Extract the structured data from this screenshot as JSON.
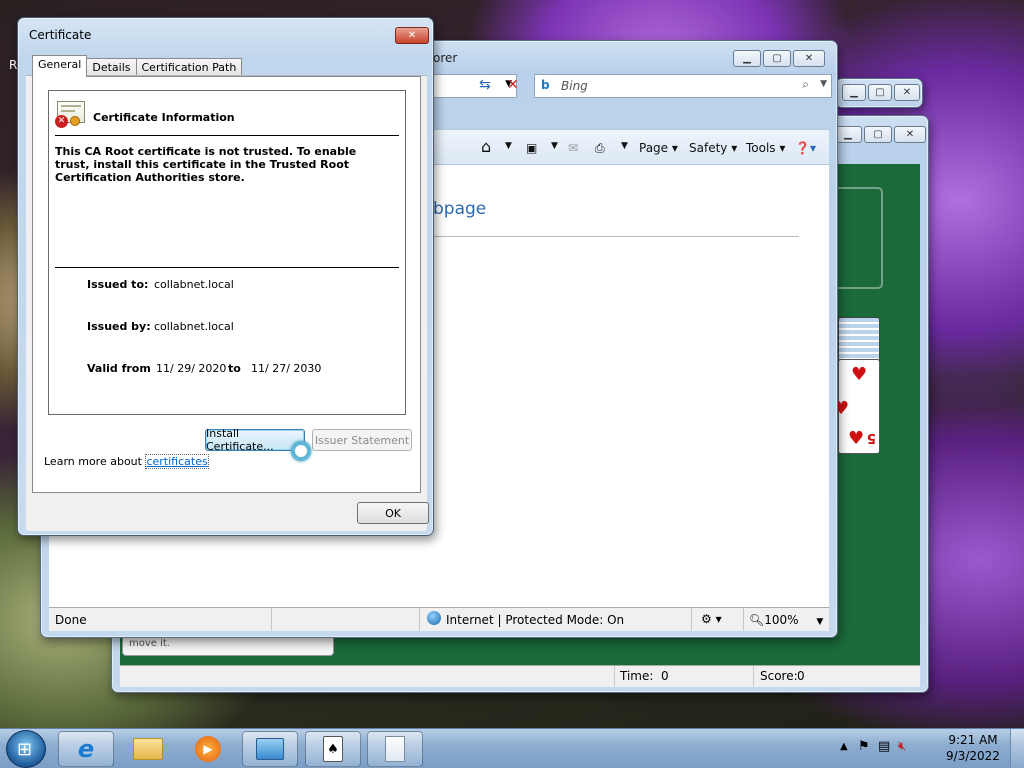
{
  "desktop": {
    "partial_text": "R"
  },
  "solitaire": {
    "time_label": "Time:",
    "time_value": "0",
    "score_label": "Score:",
    "score_value": "0",
    "tooltip_text": "move it.",
    "card_rank": "5"
  },
  "ie": {
    "title_partial": "orer",
    "search_placeholder": "Bing",
    "menu": {
      "page": "Page",
      "safety": "Safety",
      "tools": "Tools"
    },
    "content_heading_partial": "bpage",
    "status": {
      "left": "Done",
      "zone": "Internet | Protected Mode: On",
      "zoom": "100%"
    }
  },
  "dialog": {
    "title": "Certificate",
    "tabs": [
      "General",
      "Details",
      "Certification Path"
    ],
    "heading": "Certificate Information",
    "warning": "This CA Root certificate is not trusted. To enable trust, install this certificate in the Trusted Root Certification Authorities store.",
    "issued_to_label": "Issued to:",
    "issued_to_value": "collabnet.local",
    "issued_by_label": "Issued by:",
    "issued_by_value": "collabnet.local",
    "valid_from_label": "Valid from",
    "valid_from_value": "11/ 29/ 2020",
    "to_label": "to",
    "valid_to_value": "11/ 27/ 2030",
    "install_button": "Install Certificate...",
    "issuer_button": "Issuer Statement",
    "learn_more_prefix": "Learn more about ",
    "learn_more_link": "certificates",
    "ok_button": "OK"
  },
  "taskbar": {
    "clock_time": "9:21 AM",
    "clock_date": "9/3/2022"
  },
  "colors": {
    "felt": "#1a6a3a",
    "link": "#0066cc",
    "heading_blue": "#2a6ab0"
  }
}
